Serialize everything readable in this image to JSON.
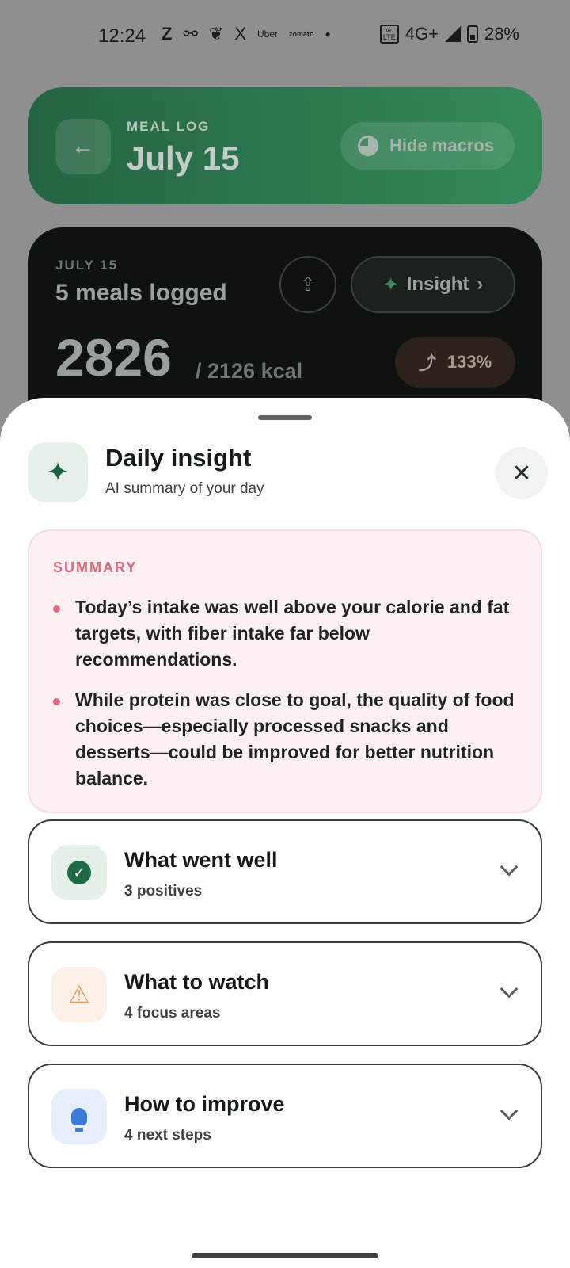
{
  "status_bar": {
    "time": "12:24",
    "network": "4G+",
    "battery": "28%",
    "notif_icons": [
      "Z",
      "X",
      "Uber",
      "zomato"
    ]
  },
  "header": {
    "eyebrow": "MEAL LOG",
    "title": "July 15",
    "macros_button": "Hide macros"
  },
  "day_card": {
    "date": "JULY 15",
    "meals": "5 meals logged",
    "insight_button": "Insight",
    "kcal": "2826",
    "goal": "/ 2126 kcal",
    "percent": "133%"
  },
  "sheet": {
    "title": "Daily insight",
    "subtitle": "AI summary of your day",
    "summary": {
      "label": "SUMMARY",
      "bullets": [
        "Today’s intake was well above your calorie and fat targets, with fiber intake far below recommendations.",
        "While protein was close to goal, the quality of food choices—especially processed snacks and desserts—could be improved for better nutrition balance."
      ]
    },
    "sections": [
      {
        "title": "What went well",
        "subtitle": "3 positives",
        "icon": "check-icon",
        "color": "#1f6b46"
      },
      {
        "title": "What to watch",
        "subtitle": "4 focus areas",
        "icon": "warning-icon",
        "color": "#e59a5d"
      },
      {
        "title": "How to improve",
        "subtitle": "4 next steps",
        "icon": "bulb-icon",
        "color": "#3c7bd9"
      }
    ]
  }
}
